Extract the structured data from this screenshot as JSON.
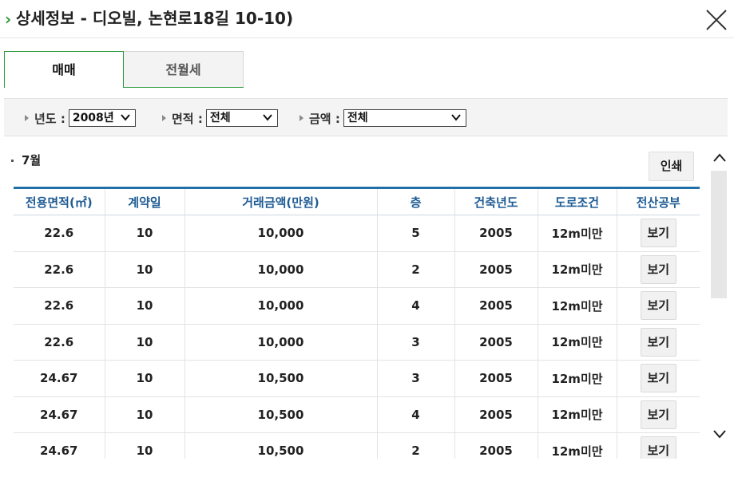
{
  "header": {
    "title": "상세정보 - 디오빌, 논현로18길 10-10)"
  },
  "tabs": [
    {
      "label": "매매",
      "active": true
    },
    {
      "label": "전월세",
      "active": false
    }
  ],
  "filters": {
    "year": {
      "label": "년도 :",
      "selected": "2008년"
    },
    "area": {
      "label": "면적 :",
      "selected": "전체"
    },
    "price": {
      "label": "금액 :",
      "selected": "전체"
    }
  },
  "month_label": "7월",
  "print_label": "인쇄",
  "table": {
    "headers": [
      "전용면적(㎡)",
      "계약일",
      "거래금액(만원)",
      "층",
      "건축년도",
      "도로조건",
      "전산공부"
    ],
    "rows": [
      {
        "area": "22.6",
        "day": "10",
        "price": "10,000",
        "floor": "5",
        "built": "2005",
        "road": "12m미만",
        "doc": "보기"
      },
      {
        "area": "22.6",
        "day": "10",
        "price": "10,000",
        "floor": "2",
        "built": "2005",
        "road": "12m미만",
        "doc": "보기"
      },
      {
        "area": "22.6",
        "day": "10",
        "price": "10,000",
        "floor": "4",
        "built": "2005",
        "road": "12m미만",
        "doc": "보기"
      },
      {
        "area": "22.6",
        "day": "10",
        "price": "10,000",
        "floor": "3",
        "built": "2005",
        "road": "12m미만",
        "doc": "보기"
      },
      {
        "area": "24.67",
        "day": "10",
        "price": "10,500",
        "floor": "3",
        "built": "2005",
        "road": "12m미만",
        "doc": "보기"
      },
      {
        "area": "24.67",
        "day": "10",
        "price": "10,500",
        "floor": "4",
        "built": "2005",
        "road": "12m미만",
        "doc": "보기"
      },
      {
        "area": "24.67",
        "day": "10",
        "price": "10,500",
        "floor": "2",
        "built": "2005",
        "road": "12m미만",
        "doc": "보기"
      }
    ]
  },
  "colors": {
    "accent_green": "#2c9a3a",
    "header_blue": "#1f5c94",
    "table_top_border": "#1f6fa8"
  },
  "icons": {
    "title_marker": "chevron-right-icon",
    "close": "close-icon",
    "select_arrow": "chevron-down-icon",
    "scroll_up": "chevron-up-icon",
    "scroll_down": "chevron-down-icon"
  }
}
